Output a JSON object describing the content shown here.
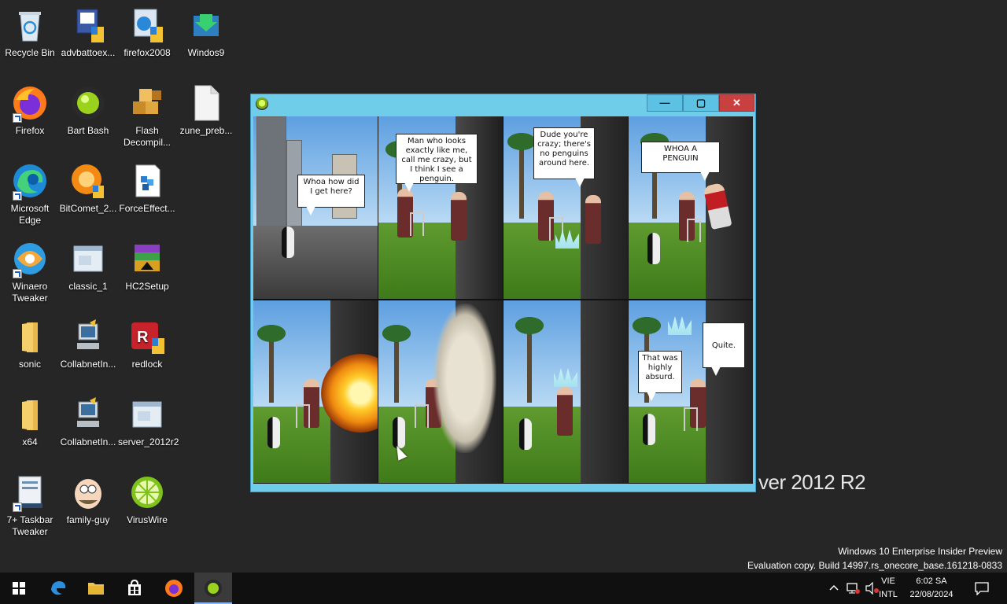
{
  "desktop": {
    "icons": [
      {
        "label": "Recycle Bin",
        "icon": "recycle-bin-icon"
      },
      {
        "label": "advbattoex...",
        "icon": "installer-icon"
      },
      {
        "label": "firefox2008",
        "icon": "installer-icon"
      },
      {
        "label": "Windos9",
        "icon": "download-arrow-icon"
      },
      {
        "label": "Firefox",
        "icon": "firefox-icon"
      },
      {
        "label": "Bart Bash",
        "icon": "gear-ball-icon"
      },
      {
        "label": "Flash Decompil...",
        "icon": "cubes-icon"
      },
      {
        "label": "zune_preb...",
        "icon": "file-icon"
      },
      {
        "label": "Microsoft Edge",
        "icon": "edge-icon"
      },
      {
        "label": "BitComet_2...",
        "icon": "bitcomet-icon"
      },
      {
        "label": "ForceEffect...",
        "icon": "blocks-icon"
      },
      {
        "label": "Winaero Tweaker",
        "icon": "winaero-icon"
      },
      {
        "label": "classic_1",
        "icon": "window-icon"
      },
      {
        "label": "HC2Setup",
        "icon": "archive-icon"
      },
      {
        "label": "sonic",
        "icon": "folder-icon"
      },
      {
        "label": "CollabnetIn...",
        "icon": "computer-icon"
      },
      {
        "label": "redlock",
        "icon": "redlock-icon"
      },
      {
        "label": "x64",
        "icon": "folder-icon"
      },
      {
        "label": "CollabnetIn...",
        "icon": "computer-icon"
      },
      {
        "label": "server_2012r2",
        "icon": "window-icon"
      },
      {
        "label": "7+ Taskbar Tweaker",
        "icon": "tweaker-icon"
      },
      {
        "label": "family-guy",
        "icon": "peter-icon"
      },
      {
        "label": "VirusWire",
        "icon": "lime-icon"
      }
    ],
    "logo_text": "ver 2012 R2",
    "watermark": {
      "line1": "Windows 10 Enterprise Insider Preview",
      "line2": "Evaluation copy. Build 14997.rs_onecore_base.161218-0833"
    }
  },
  "window": {
    "controls": {
      "minimize": "—",
      "maximize": "▢",
      "close": "✕"
    },
    "comic": {
      "bubbles": [
        "Whoa how did I get here?",
        "Man who looks exactly like me, call me crazy, but I think I see a penguin.",
        "Dude you're crazy; there's no penguins around here.",
        "WHOA A PENGUIN",
        "That was highly absurd.",
        "Quite."
      ]
    }
  },
  "taskbar": {
    "lang_top": "VIE",
    "lang_bottom": "INTL",
    "time": "6:02 SA",
    "date": "22/08/2024"
  },
  "colors": {
    "window_frame": "#6fcdea",
    "close": "#c84040",
    "taskbar": "#101010",
    "desktop": "#262626"
  }
}
